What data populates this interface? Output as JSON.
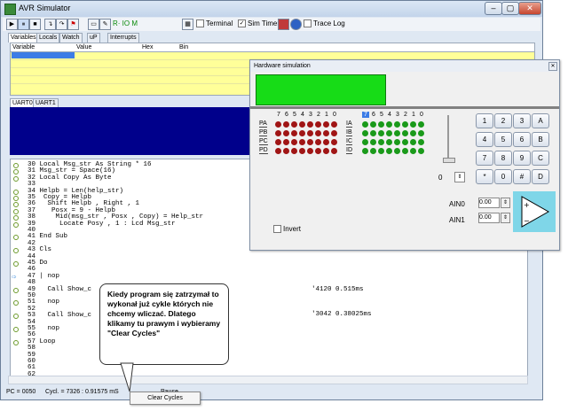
{
  "window": {
    "title": "AVR Simulator",
    "min": "–",
    "max": "▢",
    "close": "✕"
  },
  "toolbar": {
    "play": "▶",
    "pause": "⏸",
    "stop": "■",
    "rio": "R· IO M",
    "terminal": "Terminal",
    "sim_timers": "Sim Timers",
    "sim_timers_checked": "✓",
    "trace_log": "Trace Log"
  },
  "tabs": [
    "Variables",
    "Locals",
    "Watch",
    "uP",
    "Interrupts"
  ],
  "variables": {
    "columns": [
      "Variable",
      "Value",
      "Hex",
      "Bin"
    ]
  },
  "uart_tabs": [
    "UART0",
    "UART1"
  ],
  "code": [
    {
      "n": "30",
      "t": "Local Msg_str As String * 16"
    },
    {
      "n": "31",
      "t": "Msg_str = Space(16)"
    },
    {
      "n": "32",
      "t": "Local Copy As Byte"
    },
    {
      "n": "33",
      "t": ""
    },
    {
      "n": "34",
      "t": "Helpb = Len(help_str)"
    },
    {
      "n": "35",
      "t": " Copy = Helpb"
    },
    {
      "n": "36",
      "t": "  Shift Helpb , Right , 1"
    },
    {
      "n": "37",
      "t": "   Posx = 9 - Helpb"
    },
    {
      "n": "38",
      "t": "    Mid(msg_str , Posx , Copy) = Help_str"
    },
    {
      "n": "39",
      "t": "     Locate Posy , 1 : Lcd Msg_str"
    },
    {
      "n": "40",
      "t": ""
    },
    {
      "n": "41",
      "t": "End Sub"
    },
    {
      "n": "42",
      "t": ""
    },
    {
      "n": "43",
      "t": "Cls"
    },
    {
      "n": "44",
      "t": ""
    },
    {
      "n": "45",
      "t": "Do"
    },
    {
      "n": "46",
      "t": ""
    },
    {
      "n": "47",
      "t": "| nop"
    },
    {
      "n": "48",
      "t": ""
    },
    {
      "n": "49",
      "t": "  Call Show_c"
    },
    {
      "n": "50",
      "t": ""
    },
    {
      "n": "51",
      "t": "  nop"
    },
    {
      "n": "52",
      "t": ""
    },
    {
      "n": "53",
      "t": "  Call Show_c"
    },
    {
      "n": "54",
      "t": ""
    },
    {
      "n": "55",
      "t": "  nop"
    },
    {
      "n": "56",
      "t": ""
    },
    {
      "n": "57",
      "t": "Loop"
    },
    {
      "n": "58",
      "t": ""
    },
    {
      "n": "59",
      "t": ""
    },
    {
      "n": "60",
      "t": ""
    },
    {
      "n": "61",
      "t": ""
    },
    {
      "n": "62",
      "t": ""
    }
  ],
  "cycles": [
    "'4120 0.515ms",
    "'3042 0.38025ms"
  ],
  "status": {
    "pc": "PC = 0050",
    "cycl": "Cycl. = 7326 : 0.91575 mS",
    "pause": "Pause"
  },
  "context_menu": {
    "item": "Clear Cycles"
  },
  "tooltip": "Kiedy program się zatrzymał to wykonał już cykle których nie chcemy wliczać. Dlatego klikamy tu prawym i wybieramy \"Clear Cycles\"",
  "hw": {
    "title": "Hardware simulation",
    "bits": [
      "7",
      "6",
      "5",
      "4",
      "3",
      "2",
      "1",
      "0"
    ],
    "out_ports": [
      "PA",
      "PB",
      "PC",
      "PD"
    ],
    "in_ports": [
      "IA",
      "IB",
      "IC",
      "ID"
    ],
    "slider_value": "0",
    "invert": "Invert",
    "keys": [
      "1",
      "2",
      "3",
      "A",
      "4",
      "5",
      "6",
      "B",
      "7",
      "8",
      "9",
      "C",
      "*",
      "0",
      "#",
      "D"
    ],
    "ain0_label": "AIN0",
    "ain0": "0.00",
    "ain1_label": "AIN1",
    "ain1": "0.00",
    "colors": {
      "lcd": "#17dc17",
      "led_red": "#a01515",
      "led_green": "#1a9a1a",
      "uart": "#00008b"
    }
  }
}
